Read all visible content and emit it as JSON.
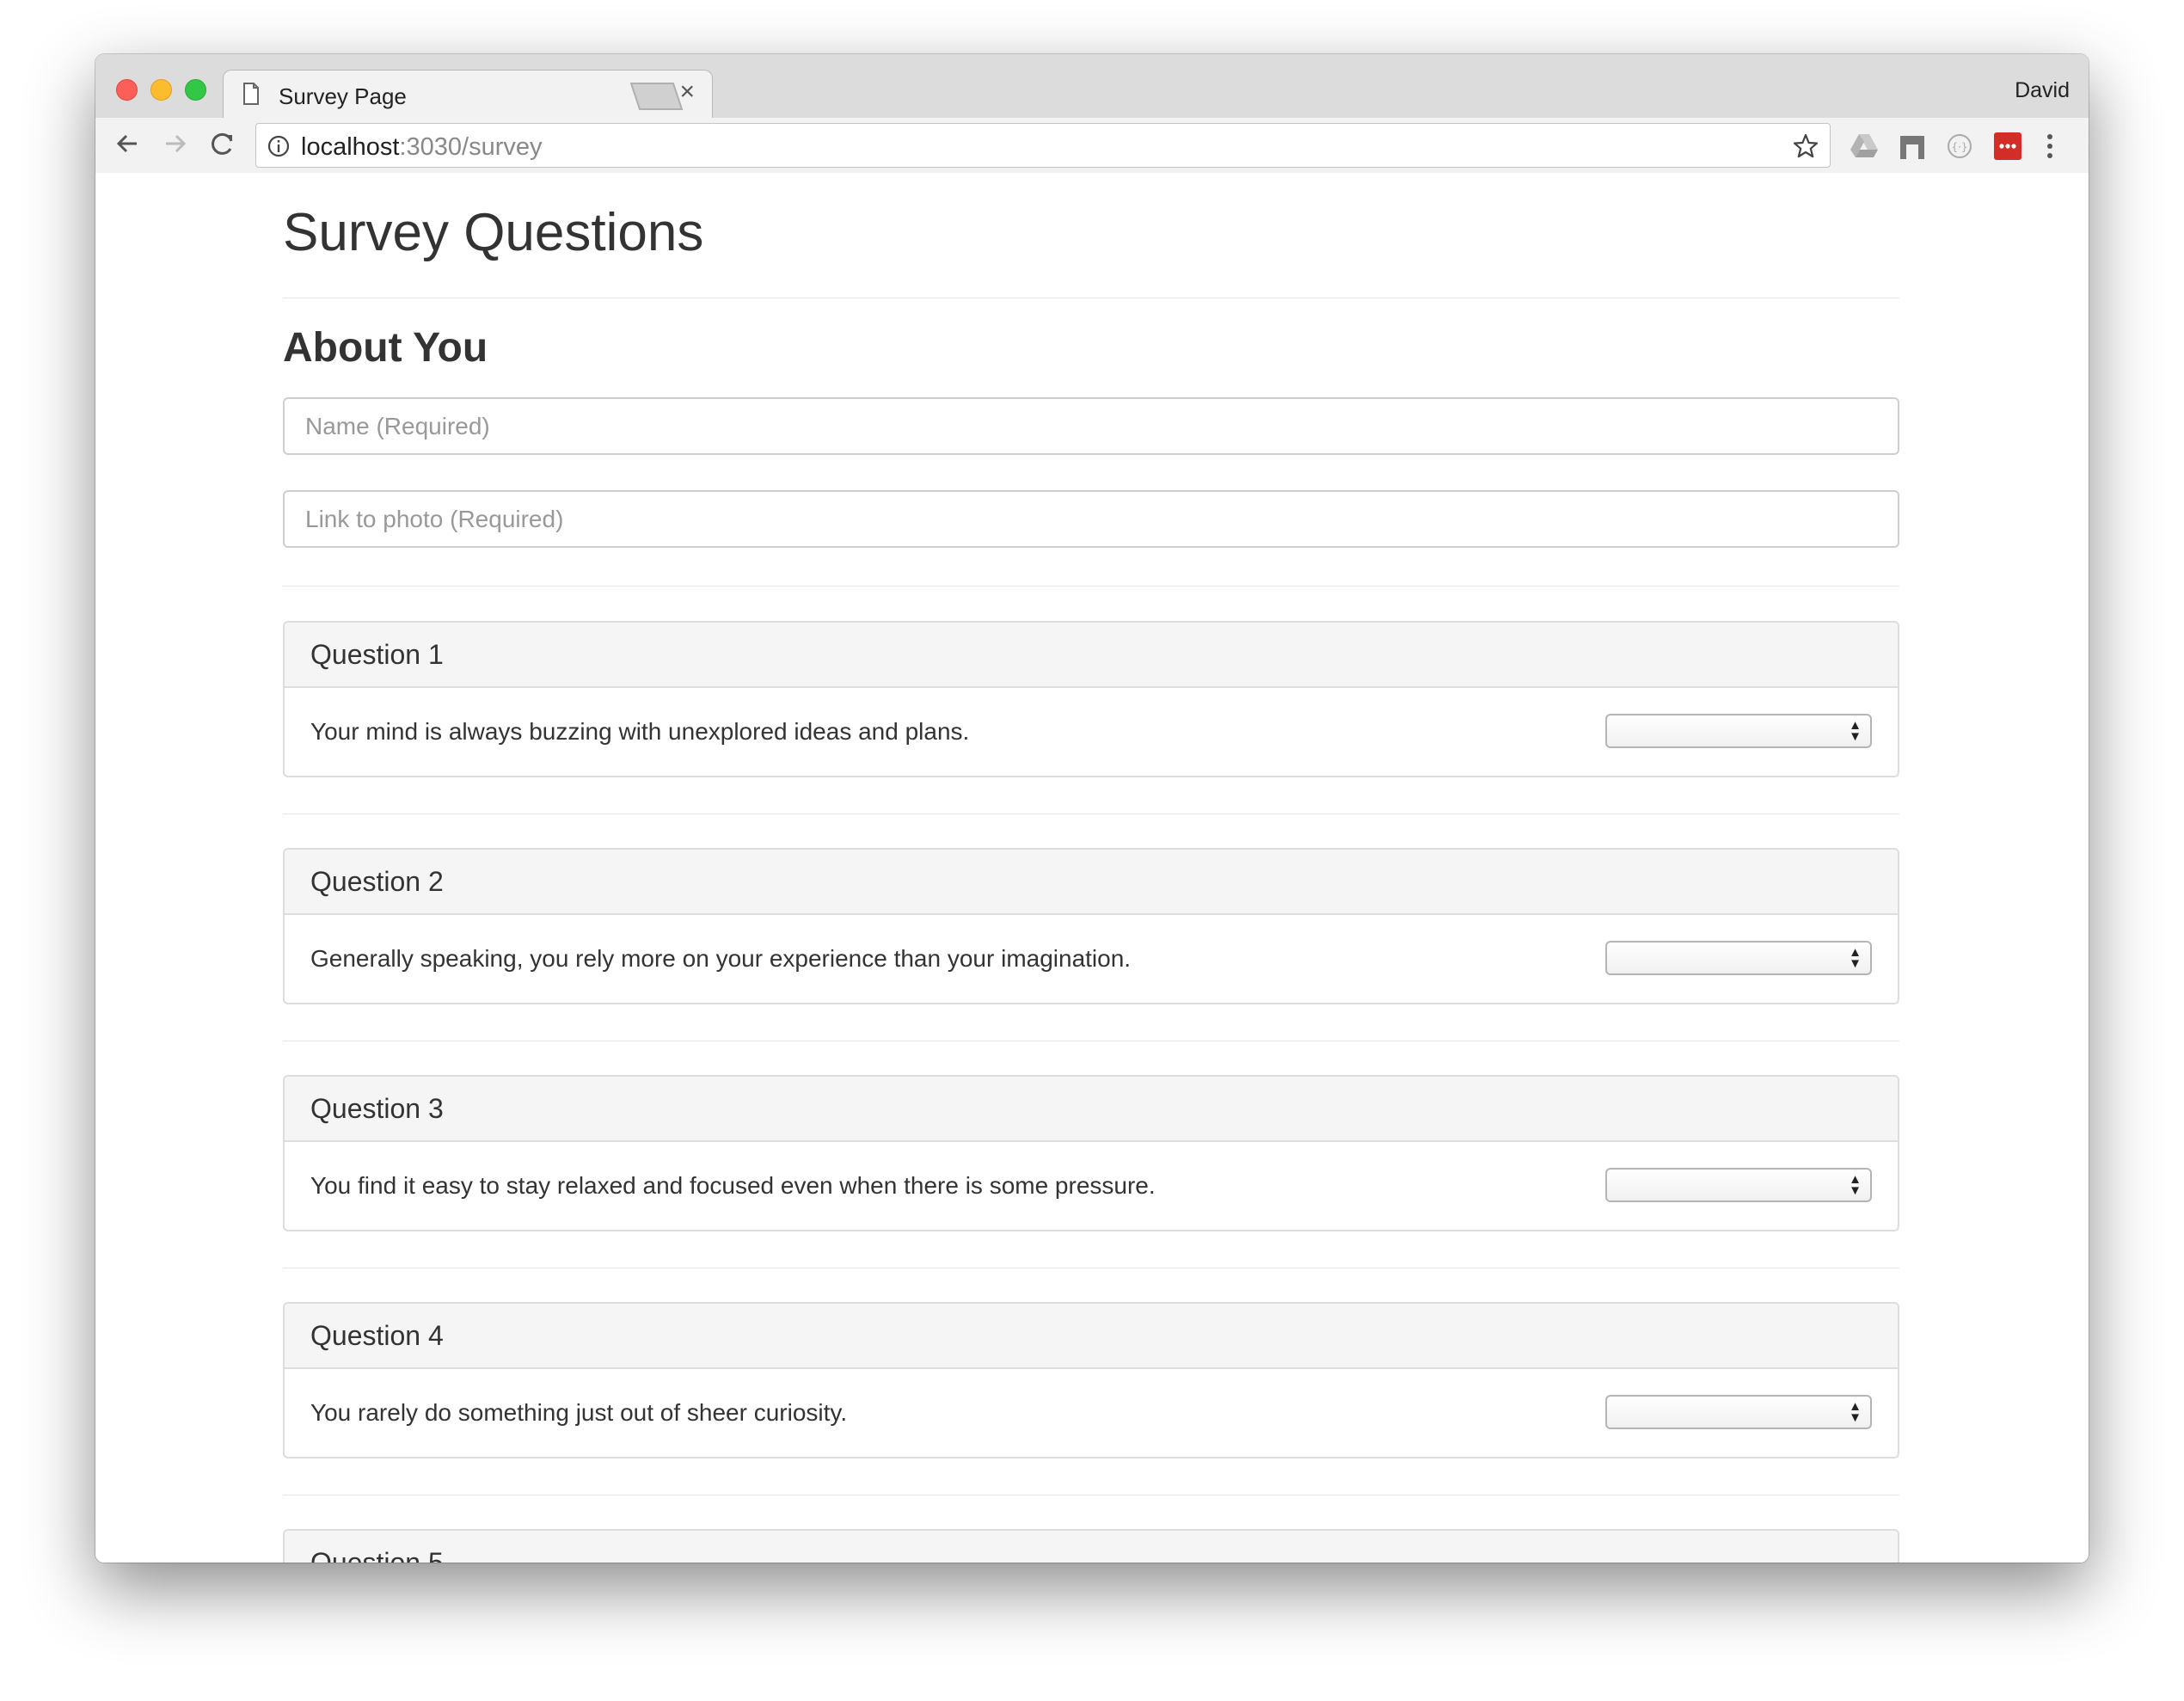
{
  "browser": {
    "tab_title": "Survey Page",
    "tab_close": "×",
    "profile_name": "David",
    "url_host": "localhost",
    "url_path": ":3030/survey"
  },
  "page": {
    "title": "Survey Questions",
    "about_heading": "About You",
    "name_placeholder": "Name (Required)",
    "photo_placeholder": "Link to photo (Required)"
  },
  "questions": [
    {
      "label": "Question 1",
      "text": "Your mind is always buzzing with unexplored ideas and plans.",
      "selected": ""
    },
    {
      "label": "Question 2",
      "text": "Generally speaking, you rely more on your experience than your imagination.",
      "selected": ""
    },
    {
      "label": "Question 3",
      "text": "You find it easy to stay relaxed and focused even when there is some pressure.",
      "selected": ""
    },
    {
      "label": "Question 4",
      "text": "You rarely do something just out of sheer curiosity.",
      "selected": ""
    },
    {
      "label": "Question 5",
      "text": "",
      "selected": ""
    }
  ],
  "icons": {
    "back": "back-arrow-icon",
    "forward": "forward-arrow-icon",
    "reload": "reload-icon",
    "info": "info-icon",
    "bookmark": "star-icon",
    "extensions": [
      "google-drive-icon",
      "extension-icon",
      "extension-circle-icon",
      "lastpass-icon"
    ],
    "menu": "more-vertical-icon"
  },
  "colors": {
    "close_button": "#fc5f57",
    "minimize_button": "#fdbc2e",
    "zoom_button": "#33c748",
    "lastpass": "#d32d27"
  }
}
